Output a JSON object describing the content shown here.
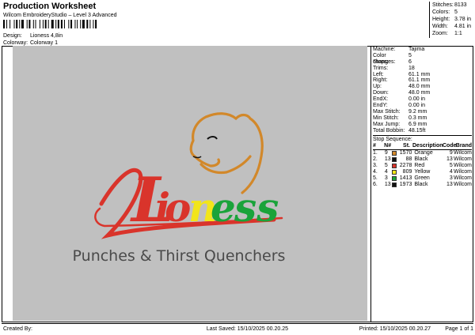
{
  "header": {
    "title": "Production Worksheet",
    "subtitle": "Wilcom EmbroideryStudio – Level 3 Advanced",
    "design_label": "Design:",
    "design_value": "Lioness 4,8in",
    "colorway_label": "Colorway:",
    "colorway_value": "Colorway 1"
  },
  "summary": [
    {
      "k": "Stitches:",
      "v": "8133"
    },
    {
      "k": "Colors:",
      "v": "5"
    },
    {
      "k": "Height:",
      "v": "3.78 in"
    },
    {
      "k": "Width:",
      "v": "4.81 in"
    },
    {
      "k": "Zoom:",
      "v": "1:1"
    }
  ],
  "props": [
    {
      "k": "Machine:",
      "v": "Tajima"
    },
    {
      "k": "Color changes:",
      "v": "5"
    },
    {
      "k": "Stops:",
      "v": "6"
    },
    {
      "k": "Trims:",
      "v": "18"
    },
    {
      "k": "Left:",
      "v": "61.1 mm"
    },
    {
      "k": "Right:",
      "v": "61.1 mm"
    },
    {
      "k": "Up:",
      "v": "48.0 mm"
    },
    {
      "k": "Down:",
      "v": "48.0 mm"
    },
    {
      "k": "EndX:",
      "v": "0.00 in"
    },
    {
      "k": "EndY:",
      "v": "0.00 in"
    },
    {
      "k": "Max Stitch:",
      "v": "9.2 mm"
    },
    {
      "k": "Min Stitch:",
      "v": "0.3 mm"
    },
    {
      "k": "Max Jump:",
      "v": "6.9 mm"
    },
    {
      "k": "Total Bobbin:",
      "v": "48.15ft"
    }
  ],
  "sequence": {
    "title": "Stop Sequence:",
    "headers": [
      "#",
      "N#",
      "St.",
      "Description",
      "Code",
      "Brand"
    ],
    "rows": [
      {
        "n": "1.",
        "s": "9",
        "st": "1570",
        "d": "Orange",
        "c": "9",
        "b": "Wilcom",
        "color": "#d2882a"
      },
      {
        "n": "2.",
        "s": "13",
        "st": "88",
        "d": "Black",
        "c": "13",
        "b": "Wilcom",
        "color": "#111111"
      },
      {
        "n": "3.",
        "s": "5",
        "st": "2278",
        "d": "Red",
        "c": "5",
        "b": "Wilcom",
        "color": "#d9342b"
      },
      {
        "n": "4.",
        "s": "4",
        "st": "809",
        "d": "Yellow",
        "c": "4",
        "b": "Wilcom",
        "color": "#f2e51a"
      },
      {
        "n": "5.",
        "s": "3",
        "st": "1413",
        "d": "Green",
        "c": "3",
        "b": "Wilcom",
        "color": "#1aa33a"
      },
      {
        "n": "6.",
        "s": "13",
        "st": "1973",
        "d": "Black",
        "c": "13",
        "b": "Wilcom",
        "color": "#111111"
      }
    ]
  },
  "design": {
    "text_main_letters": [
      {
        "t": "L",
        "color": "#d9342b"
      },
      {
        "t": "i",
        "color": "#d9342b"
      },
      {
        "t": "o",
        "color": "#d9342b"
      },
      {
        "t": "n",
        "color": "#f2e51a"
      },
      {
        "t": "e",
        "color": "#1aa33a"
      },
      {
        "t": "ss",
        "color": "#1aa33a"
      }
    ],
    "tagline": "Punches & Thirst Quenchers",
    "tagline_color": "#4a4a4a",
    "outline_color": "#d2882a"
  },
  "footer": {
    "created": "Created By:",
    "saved": "Last Saved: 15/10/2025 00.20.25",
    "printed": "Printed: 15/10/2025 00.20.27",
    "page": "Page 1 of 1"
  }
}
